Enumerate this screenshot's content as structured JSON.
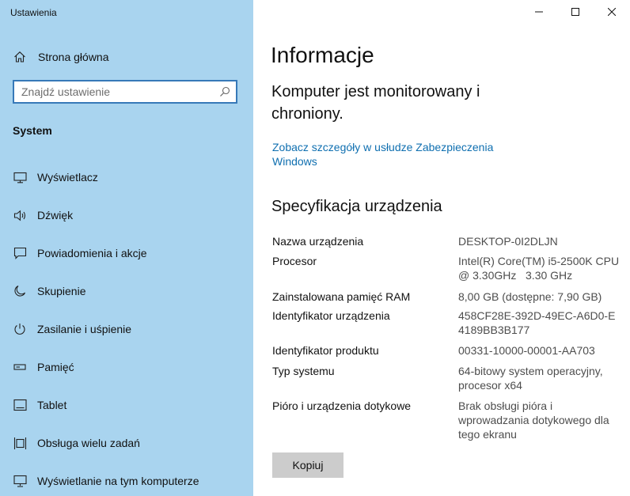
{
  "app": {
    "title": "Ustawienia"
  },
  "window_controls": {
    "minimize": "minimize-icon",
    "maximize": "maximize-icon",
    "close": "close-icon"
  },
  "sidebar": {
    "home": {
      "label": "Strona główna",
      "icon": "home-icon"
    },
    "search": {
      "placeholder": "Znajdź ustawienie",
      "value": "",
      "icon": "search-icon"
    },
    "category": "System",
    "items": [
      {
        "label": "Wyświetlacz",
        "icon": "display-icon"
      },
      {
        "label": "Dźwięk",
        "icon": "sound-icon"
      },
      {
        "label": "Powiadomienia i akcje",
        "icon": "notifications-icon"
      },
      {
        "label": "Skupienie",
        "icon": "focus-moon-icon"
      },
      {
        "label": "Zasilanie i uśpienie",
        "icon": "power-icon"
      },
      {
        "label": "Pamięć",
        "icon": "storage-icon"
      },
      {
        "label": "Tablet",
        "icon": "tablet-icon"
      },
      {
        "label": "Obsługa wielu zadań",
        "icon": "multitasking-icon"
      },
      {
        "label": "Wyświetlanie na tym komputerze",
        "icon": "projecting-icon"
      }
    ],
    "colors": {
      "background": "#a9d4ef",
      "search_border": "#3779b8"
    }
  },
  "main": {
    "title": "Informacje",
    "status": "Komputer jest monitorowany i chroniony.",
    "security_link": "Zobacz szczegóły w usłudze Zabezpieczenia Windows",
    "spec_heading": "Specyfikacja urządzenia",
    "specs": [
      {
        "key": "Nazwa urządzenia",
        "value": "DESKTOP-0I2DLJN"
      },
      {
        "key": "Procesor",
        "value": "Intel(R) Core(TM) i5-2500K CPU @ 3.30GHz   3.30 GHz"
      },
      {
        "key": "Zainstalowana pamięć RAM",
        "value": "8,00 GB (dostępne: 7,90 GB)"
      },
      {
        "key": "Identyfikator urządzenia",
        "value": "458CF28E-392D-49EC-A6D0-E4189BB3B177"
      },
      {
        "key": "Identyfikator produktu",
        "value": "00331-10000-00001-AA703"
      },
      {
        "key": "Typ systemu",
        "value": "64-bitowy system operacyjny, procesor x64"
      },
      {
        "key": "Pióro i urządzenia dotykowe",
        "value": "Brak obsługi pióra i wprowadzania dotykowego dla tego ekranu"
      }
    ],
    "copy_button": "Kopiuj",
    "colors": {
      "link": "#0f6fb0",
      "value_text": "#4d4d4d",
      "button_bg": "#cccccc"
    }
  }
}
